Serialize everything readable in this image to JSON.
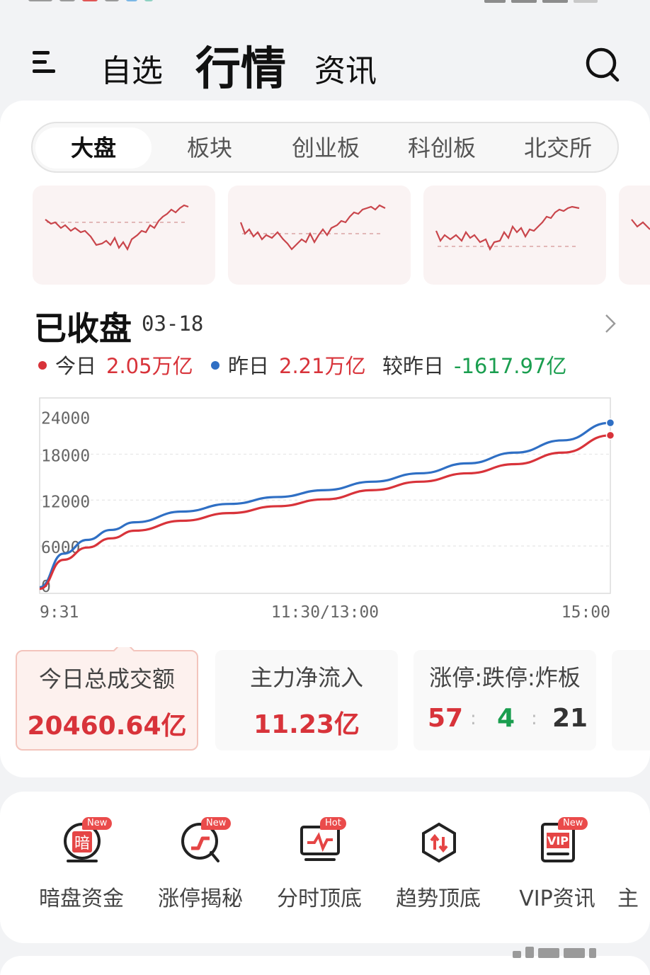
{
  "nav": {
    "tabs": [
      {
        "label": "自选",
        "active": false
      },
      {
        "label": "行情",
        "active": true
      },
      {
        "label": "资讯",
        "active": false
      }
    ],
    "menu_icon": "menu-icon",
    "search_icon": "search-icon"
  },
  "segments": [
    "大盘",
    "板块",
    "创业板",
    "科创板",
    "北交所"
  ],
  "active_segment": "大盘",
  "market": {
    "status": "已收盘",
    "date": "03-18"
  },
  "legend": {
    "today_label": "今日",
    "today_value": "2.05万亿",
    "yesterday_label": "昨日",
    "yesterday_value": "2.21万亿",
    "diff_label": "较昨日",
    "diff_value": "-1617.97亿"
  },
  "colors": {
    "up_red": "#d8333a",
    "down_green": "#1a9e4f",
    "yesterday_blue": "#2f6fc4",
    "accent": "#ea4b4b"
  },
  "chart_data": {
    "type": "line",
    "x_ticks": [
      "9:31",
      "11:30/13:00",
      "15:00"
    ],
    "y_ticks": [
      "24000",
      "18000",
      "12000",
      "6000",
      "0"
    ],
    "ylim": [
      0,
      24000
    ],
    "xlim": [
      0,
      240
    ],
    "grid": true,
    "series": [
      {
        "name": "今日",
        "color": "#d8333a",
        "x": [
          0,
          10,
          20,
          30,
          40,
          60,
          80,
          100,
          120,
          140,
          160,
          180,
          200,
          220,
          240
        ],
        "y": [
          400,
          4200,
          5800,
          7000,
          8000,
          9300,
          10300,
          11200,
          12100,
          13300,
          14400,
          15500,
          16700,
          18200,
          20460
        ]
      },
      {
        "name": "昨日",
        "color": "#2f6fc4",
        "x": [
          0,
          10,
          20,
          30,
          40,
          60,
          80,
          100,
          120,
          140,
          160,
          180,
          200,
          220,
          240
        ],
        "y": [
          600,
          5000,
          6800,
          8100,
          9100,
          10500,
          11500,
          12400,
          13300,
          14400,
          15500,
          16800,
          18200,
          19800,
          22100
        ]
      }
    ]
  },
  "stats": {
    "turnover_label": "今日总成交额",
    "turnover_value": "20460.64亿",
    "inflow_label": "主力净流入",
    "inflow_value": "11.23亿",
    "limit_label": "涨停:跌停:炸板",
    "limit_up": "57",
    "limit_down": "4",
    "broken": "21",
    "sep": ":"
  },
  "tools": [
    {
      "label": "暗盘资金",
      "badge": "New",
      "icon": "dark-pool-icon"
    },
    {
      "label": "涨停揭秘",
      "badge": "New",
      "icon": "limit-up-icon"
    },
    {
      "label": "分时顶底",
      "badge": "Hot",
      "icon": "intraday-chart-icon"
    },
    {
      "label": "趋势顶底",
      "badge": "",
      "icon": "trend-icon"
    },
    {
      "label": "VIP资讯",
      "badge": "New",
      "icon": "vip-icon"
    },
    {
      "label": "主",
      "badge": "",
      "icon": ""
    }
  ]
}
